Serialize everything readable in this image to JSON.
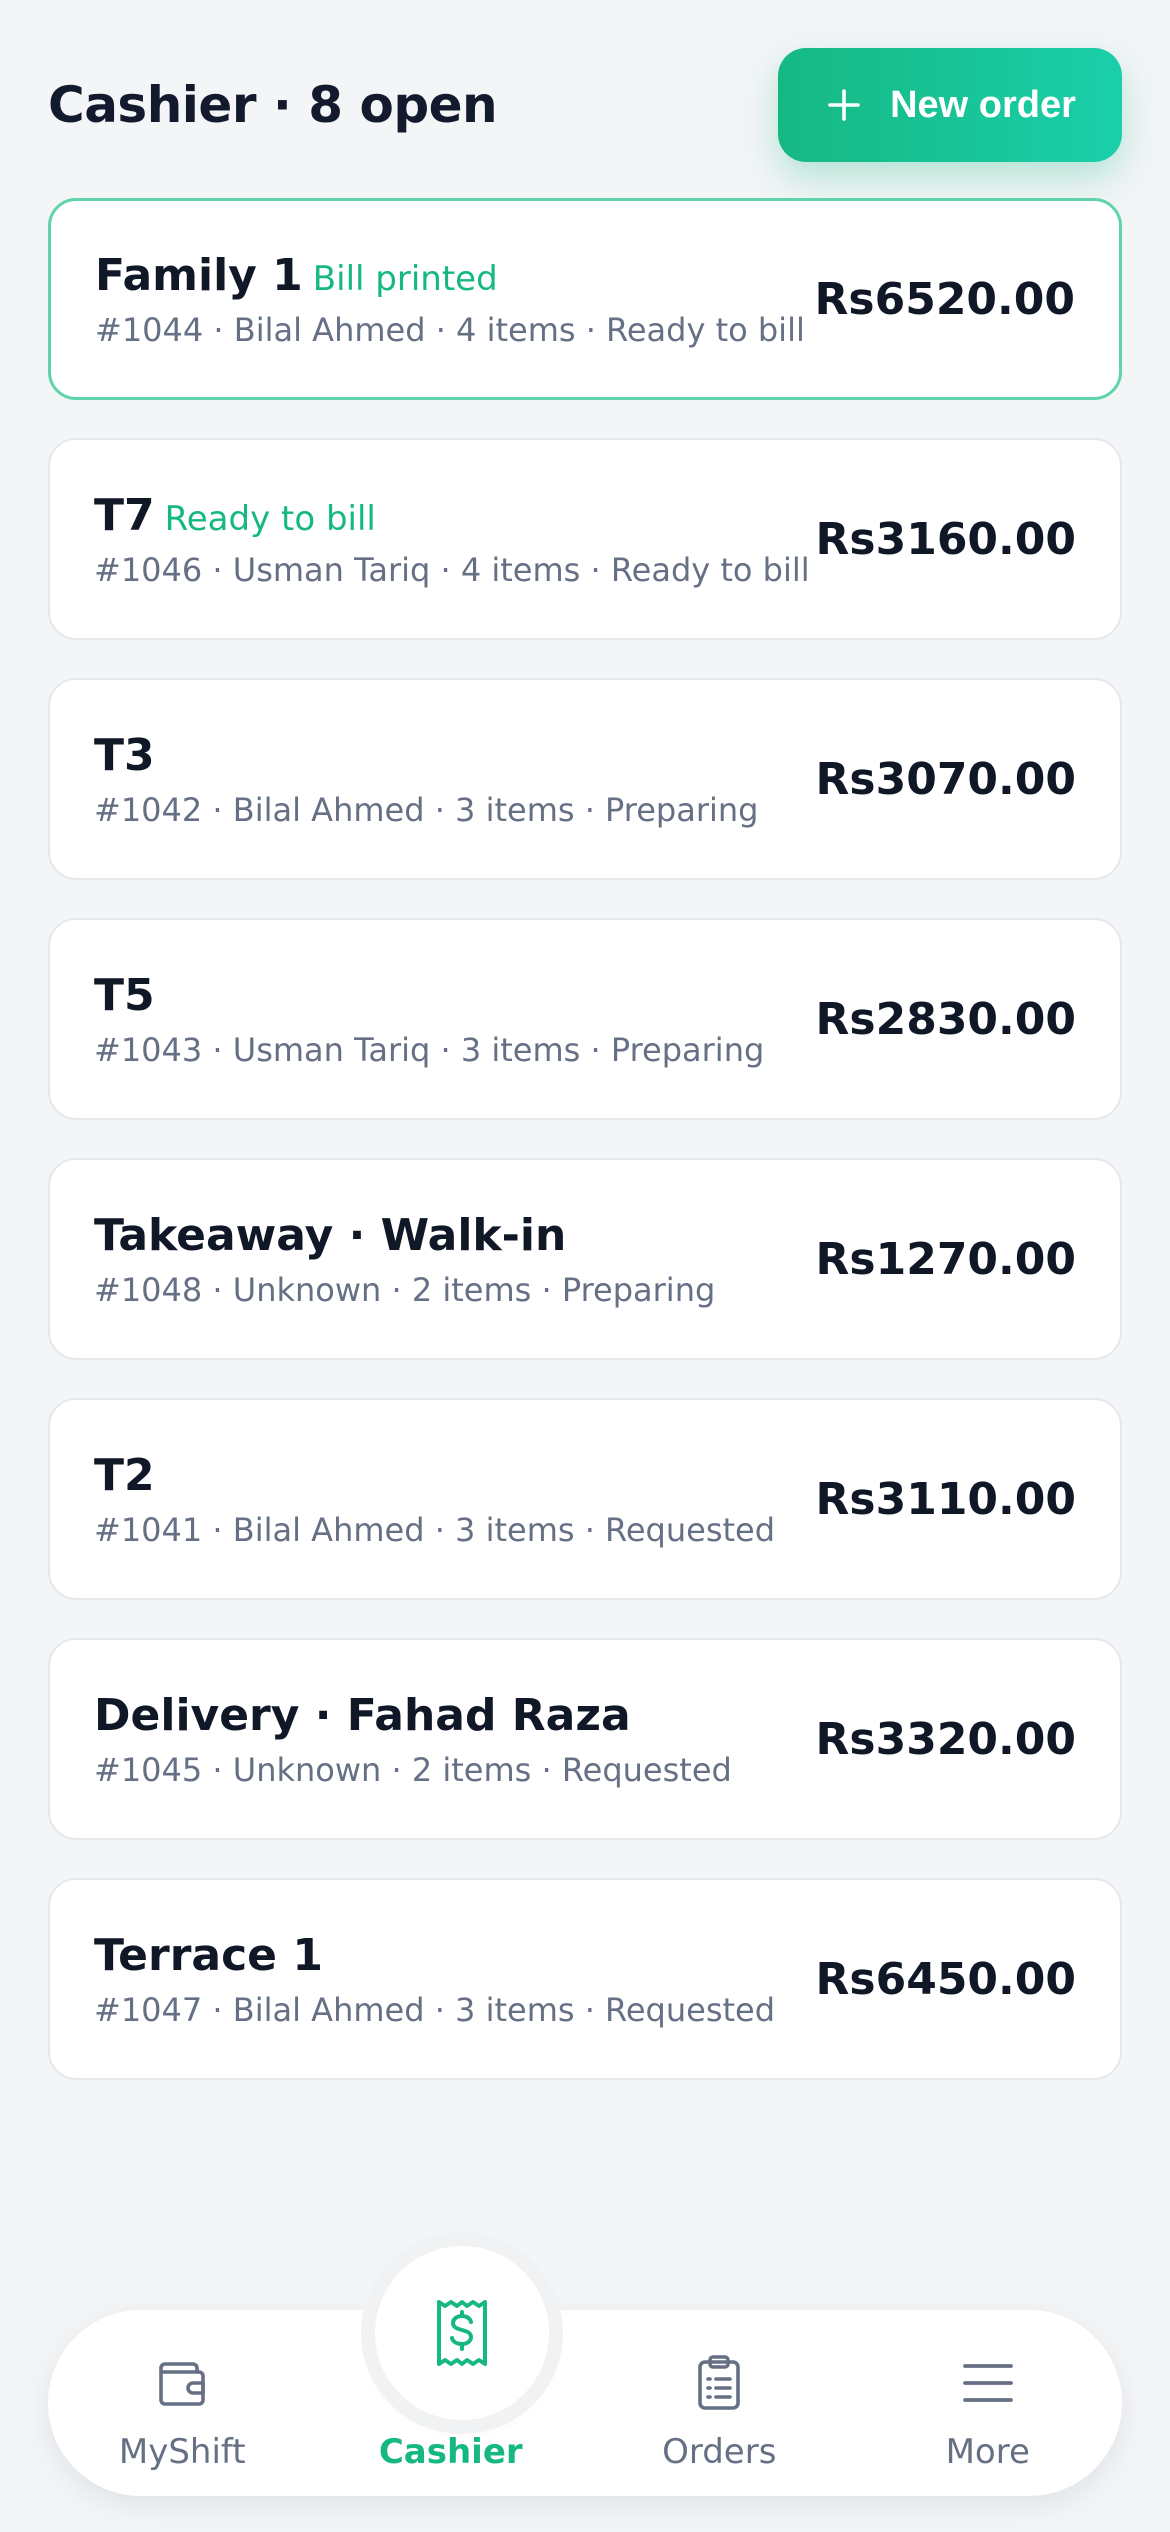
{
  "header": {
    "title": "Cashier · 8 open",
    "new_order_label": "New order"
  },
  "orders": [
    {
      "name": "Family 1",
      "badge": "Bill printed",
      "meta": "#1044 · Bilal Ahmed · 4 items · Ready to bill",
      "amount": "Rs6520.00"
    },
    {
      "name": "T7",
      "badge": "Ready to bill",
      "meta": "#1046 · Usman Tariq · 4 items · Ready to bill",
      "amount": "Rs3160.00"
    },
    {
      "name": "T3",
      "badge": "",
      "meta": "#1042 · Bilal Ahmed · 3 items · Preparing",
      "amount": "Rs3070.00"
    },
    {
      "name": "T5",
      "badge": "",
      "meta": "#1043 · Usman Tariq · 3 items · Preparing",
      "amount": "Rs2830.00"
    },
    {
      "name": "Takeaway · Walk-in",
      "badge": "",
      "meta": "#1048 · Unknown · 2 items · Preparing",
      "amount": "Rs1270.00"
    },
    {
      "name": "T2",
      "badge": "",
      "meta": "#1041 · Bilal Ahmed · 3 items · Requested",
      "amount": "Rs3110.00"
    },
    {
      "name": "Delivery · Fahad Raza",
      "badge": "",
      "meta": "#1045 · Unknown · 2 items · Requested",
      "amount": "Rs3320.00"
    },
    {
      "name": "Terrace 1",
      "badge": "",
      "meta": "#1047 · Bilal Ahmed · 3 items · Requested",
      "amount": "Rs6450.00"
    }
  ],
  "nav": {
    "items": [
      {
        "label": "MyShift",
        "icon": "wallet-icon"
      },
      {
        "label": "Cashier",
        "icon": "receipt-dollar-icon"
      },
      {
        "label": "Orders",
        "icon": "clipboard-list-icon"
      },
      {
        "label": "More",
        "icon": "menu-icon"
      }
    ],
    "active": "Cashier"
  },
  "colors": {
    "accent": "#16b882",
    "accent_light": "#1acfaa",
    "background": "#f3f5f7",
    "text_primary": "#101828",
    "text_secondary": "#667085"
  }
}
